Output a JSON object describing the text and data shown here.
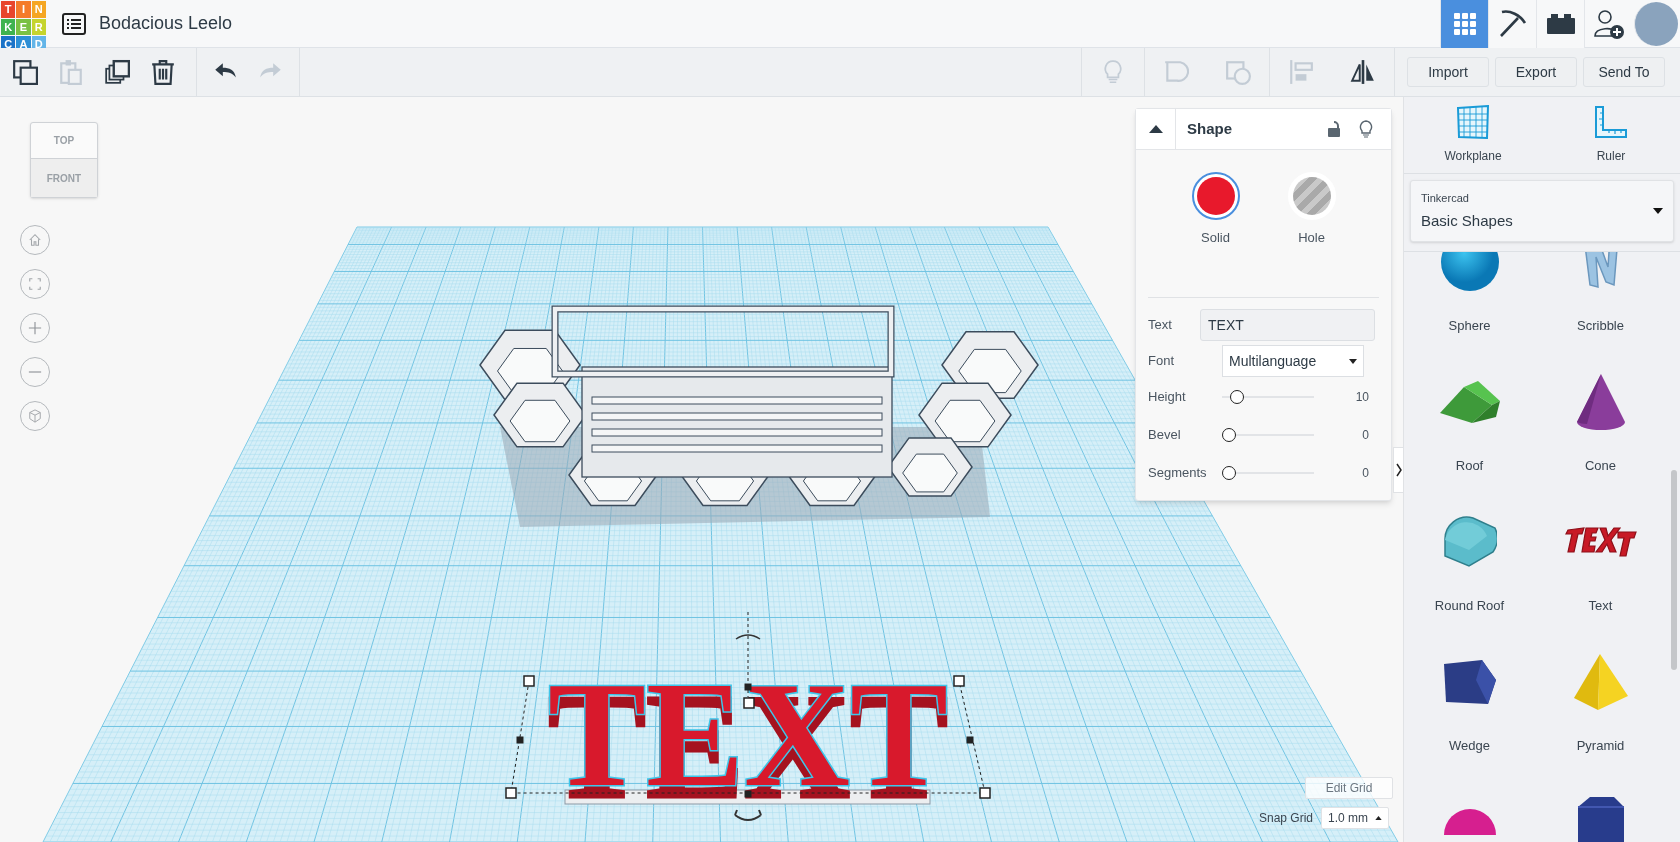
{
  "header": {
    "logo_letters": [
      "T",
      "I",
      "N",
      "K",
      "E",
      "R",
      "C",
      "A",
      "D"
    ],
    "design_title": "Bodacious Leelo",
    "view_tabs": [
      {
        "kind": "grid",
        "selected": true
      },
      {
        "kind": "pickaxe",
        "selected": false
      },
      {
        "kind": "bricks",
        "selected": false
      }
    ]
  },
  "toolbar": {
    "edit_tools": [
      {
        "kind": "copy",
        "disabled": false
      },
      {
        "kind": "paste",
        "disabled": true
      },
      {
        "kind": "duplicate",
        "disabled": false
      },
      {
        "kind": "delete",
        "disabled": false
      }
    ],
    "history": [
      {
        "kind": "undo",
        "disabled": false
      },
      {
        "kind": "redo",
        "disabled": true
      }
    ],
    "arrange_tools": [
      {
        "kind": "note",
        "disabled": true
      },
      {
        "kind": "group",
        "disabled": true
      },
      {
        "kind": "ungroup",
        "disabled": true
      },
      {
        "kind": "align",
        "disabled": true
      },
      {
        "kind": "mirror",
        "disabled": false
      }
    ],
    "buttons": [
      "Import",
      "Export",
      "Send To"
    ]
  },
  "view_cube": {
    "top": "TOP",
    "front": "FRONT"
  },
  "scene": {
    "text_object": "TEXT"
  },
  "shape_panel": {
    "title": "Shape",
    "modes": [
      {
        "label": "Solid",
        "selected": true
      },
      {
        "label": "Hole",
        "selected": false
      }
    ],
    "text_field": {
      "label": "Text",
      "value": "TEXT"
    },
    "font_field": {
      "label": "Font",
      "value": "Multilanguage"
    },
    "sliders": [
      {
        "label": "Height",
        "level": 0.1,
        "reading": "10"
      },
      {
        "label": "Bevel",
        "level": 0,
        "reading": "0"
      },
      {
        "label": "Segments",
        "level": 0,
        "reading": "0"
      }
    ]
  },
  "grid_controls": {
    "edit_grid": "Edit Grid",
    "snap_label": "Snap Grid",
    "snap_value": "1.0 mm"
  },
  "sidebar": {
    "tools": [
      {
        "kind": "workplane",
        "label": "Workplane"
      },
      {
        "kind": "ruler",
        "label": "Ruler"
      }
    ],
    "library": {
      "provider": "Tinkercad",
      "category": "Basic Shapes"
    },
    "shapes": [
      {
        "kind": "sphere",
        "label": "Sphere"
      },
      {
        "kind": "scribble",
        "label": "Scribble"
      },
      {
        "kind": "roof",
        "label": "Roof"
      },
      {
        "kind": "cone",
        "label": "Cone"
      },
      {
        "kind": "round_roof",
        "label": "Round Roof"
      },
      {
        "kind": "text",
        "label": "Text"
      },
      {
        "kind": "wedge",
        "label": "Wedge"
      },
      {
        "kind": "pyramid",
        "label": "Pyramid"
      },
      {
        "kind": "paraboloid"
      },
      {
        "kind": "polygon"
      }
    ]
  }
}
